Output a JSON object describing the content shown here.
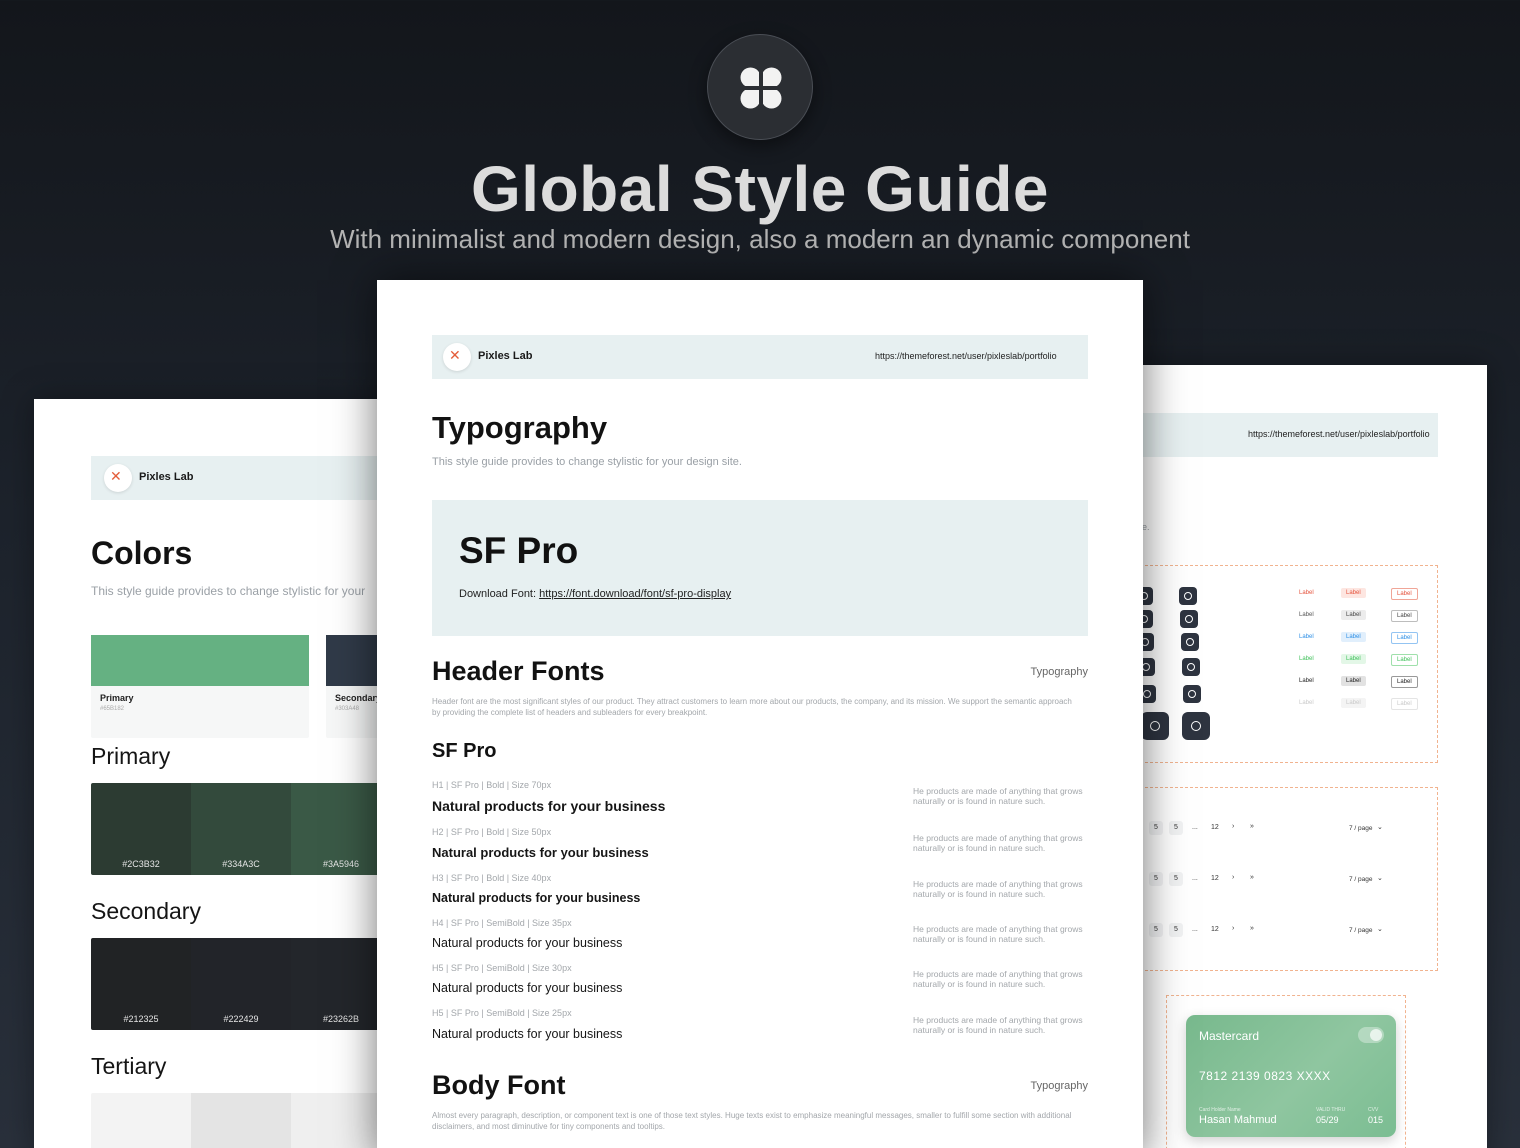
{
  "hero": {
    "title": "Global Style Guide",
    "subtitle": "With minimalist and modern design, also a modern an dynamic component",
    "icon": "four-petal-logo-icon"
  },
  "brand": {
    "name": "Pixles Lab",
    "url": "https://themeforest.net/user/pixleslab/portfolio"
  },
  "left_page": {
    "title": "Colors",
    "description": "This style guide provides to change stylistic for your",
    "swatches": [
      {
        "name": "Primary",
        "hex": "#65B182",
        "color": "#65b182"
      },
      {
        "name": "Secondary",
        "hex": "#303A48",
        "color": "#303a48"
      }
    ],
    "groups": [
      {
        "title": "Primary",
        "shades": [
          {
            "hex": "#2C3B32",
            "color": "#2c3b32"
          },
          {
            "hex": "#334A3C",
            "color": "#334a3c"
          },
          {
            "hex": "#3A5946",
            "color": "#3a5946"
          }
        ]
      },
      {
        "title": "Secondary",
        "shades": [
          {
            "hex": "#212325",
            "color": "#212325"
          },
          {
            "hex": "#222429",
            "color": "#222429"
          },
          {
            "hex": "#23262B",
            "color": "#23262b"
          }
        ]
      },
      {
        "title": "Tertiary",
        "shades": [
          {
            "hex": "",
            "color": "#f3f3f3"
          },
          {
            "hex": "",
            "color": "#e4e4e4"
          },
          {
            "hex": "",
            "color": "#efefef"
          }
        ]
      }
    ]
  },
  "center_page": {
    "title": "Typography",
    "description": "This style guide provides to change stylistic for your design site.",
    "font_box": {
      "title": "SF Pro",
      "download_label": "Download Font:",
      "download_link": "https://font.download/font/sf-pro-display"
    },
    "header_fonts": {
      "title": "Header Fonts",
      "tag": "Typography",
      "description": "Header font are the most significant styles of our product. They attract customers to learn more about our products, the company, and its mission. We support the semantic approach by providing the complete list of headers and subleaders for every breakpoint.",
      "subtitle": "SF Pro"
    },
    "type_rows": [
      {
        "meta": "H1  |  SF Pro  |  Bold  |  Size 70px",
        "sample": "Natural products for your business",
        "note": "He products are made of anything that grows naturally or is found in nature such."
      },
      {
        "meta": "H2  |  SF Pro  |  Bold  |  Size 50px",
        "sample": "Natural products for your business",
        "note": "He products are made of anything that grows naturally or is found in nature such."
      },
      {
        "meta": "H3  |  SF Pro  |  Bold  |  Size 40px",
        "sample": "Natural products for your business",
        "note": "He products are made of anything that grows naturally or is found in nature such."
      },
      {
        "meta": "H4  |  SF Pro  |  SemiBold  |  Size 35px",
        "sample": "Natural products for your business",
        "note": "He products are made of anything that grows naturally or is found in nature such."
      },
      {
        "meta": "H5  |  SF Pro  |  SemiBold  |  Size 30px",
        "sample": "Natural products for your business",
        "note": "He products are made of anything that grows naturally or is found in nature such."
      },
      {
        "meta": "H5  |  SF Pro  |  SemiBold  |  Size 25px",
        "sample": "Natural products for your business",
        "note": "He products are made of anything that grows naturally or is found in nature such."
      }
    ],
    "body_font": {
      "title": "Body Font",
      "tag": "Typography",
      "description": "Almost every paragraph, description, or component text is one of those text styles. Huge texts exist to emphasize meaningful messages, smaller to fulfill some section with additional disclaimers, and most diminutive for tiny components and tooltips."
    }
  },
  "right_page": {
    "url": "https://themeforest.net/user/pixleslab/portfolio",
    "cropped_text": "e.",
    "chip_label": "Label",
    "pagination": {
      "items": [
        "5",
        "5",
        "...",
        "12"
      ],
      "next": "›",
      "last": "»",
      "page_size": "7 / page"
    },
    "card": {
      "brand": "Mastercard",
      "number": "7812 2139 0823 XXXX",
      "holder_label": "Card Holder Name",
      "holder": "Hasan Mahmud",
      "valid_label": "VALID THRU",
      "valid": "05/29",
      "cvv_label": "CVV",
      "cvv": "015"
    }
  }
}
